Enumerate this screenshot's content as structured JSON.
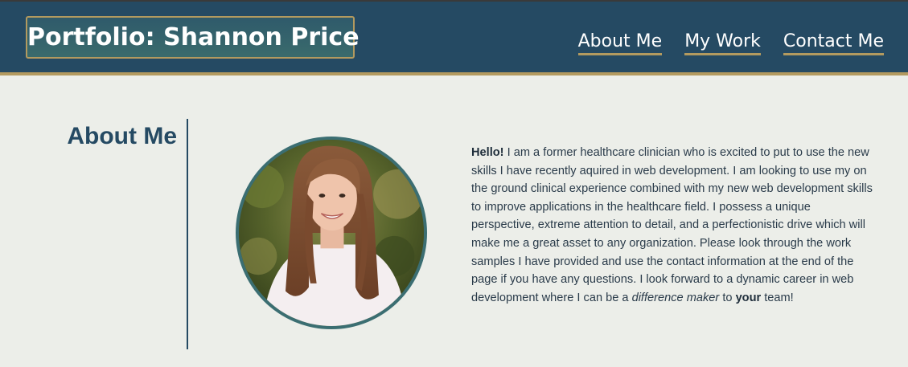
{
  "header": {
    "title": "Portfolio: Shannon Price",
    "nav": [
      {
        "label": "About Me"
      },
      {
        "label": "My Work"
      },
      {
        "label": "Contact Me"
      }
    ]
  },
  "about": {
    "heading": "About Me",
    "photo_alt": "Portrait of Shannon Price",
    "bio": {
      "greeting": "Hello!",
      "body": " I am a former healthcare clinician who is excited to put to use the new skills I have recently aquired in web development. I am looking to use my on the ground clinical experience combined with my new web development skills to improve applications in the healthcare field. I possess a unique perspective, extreme attention to detail, and a perfectionistic drive which will make me a great asset to any organization. Please look through the work samples I have provided and use the contact information at the end of the page if you have any questions. I look forward to a dynamic career in web development where I can be a ",
      "emphasis": "difference maker",
      "to": " to ",
      "your": "your",
      "end": " team!"
    }
  },
  "colors": {
    "header_bg": "#254a63",
    "accent_gold": "#b39a5f",
    "page_bg": "#eceee9",
    "heading": "#254a63",
    "photo_border": "#3b6e72"
  }
}
